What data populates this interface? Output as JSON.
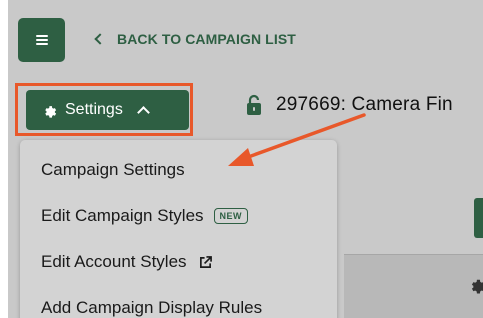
{
  "header": {
    "back_label": "BACK TO CAMPAIGN LIST"
  },
  "toolbar": {
    "settings_label": "Settings"
  },
  "campaign": {
    "title": "297669: Camera Fin"
  },
  "dropdown": {
    "items": [
      {
        "label": "Campaign Settings"
      },
      {
        "label": "Edit Campaign Styles",
        "badge": "NEW"
      },
      {
        "label": "Edit Account Styles"
      },
      {
        "label": "Add Campaign Display Rules"
      }
    ]
  },
  "icons": {
    "menu": "hamburger-icon",
    "back": "chevron-left-icon",
    "settings": "gear-icon",
    "settings_toggle": "chevron-up-icon",
    "lock": "lock-icon",
    "external": "external-link-icon"
  },
  "colors": {
    "brand_green": "#2e5f43",
    "annotation_orange": "#e8582a",
    "overlay_gray": "#c9c9c9"
  }
}
